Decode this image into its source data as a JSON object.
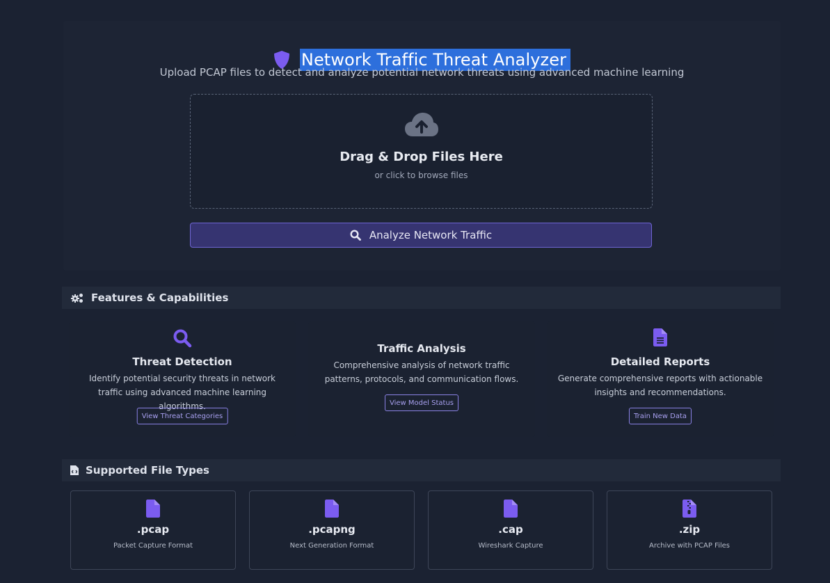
{
  "app": {
    "title": "Network Traffic Threat Analyzer",
    "subtitle": "Upload PCAP files to detect and analyze potential network threats using advanced machine learning"
  },
  "upload": {
    "drop_title": "Drag & Drop Files Here",
    "drop_subtitle": "or click to browse files",
    "icon": "cloud-upload-icon",
    "analyze_label": "Analyze Network Traffic"
  },
  "features": {
    "heading": "Features & Capabilities",
    "icon": "gears-icon",
    "items": [
      {
        "title": "Threat Detection",
        "description": "Identify potential security threats in network traffic using advanced machine learning algorithms.",
        "button": "View Threat Categories",
        "icon": "search-icon"
      },
      {
        "title": "Traffic Analysis",
        "description": "Comprehensive analysis of network traffic patterns, protocols, and communication flows.",
        "button": "View Model Status",
        "icon": ""
      },
      {
        "title": "Detailed Reports",
        "description": "Generate comprehensive reports with actionable insights and recommendations.",
        "button": "Train New Data",
        "icon": "file-text-icon"
      }
    ]
  },
  "file_types": {
    "heading": "Supported File Types",
    "icon": "file-code-icon",
    "items": [
      {
        "ext": ".pcap",
        "description": "Packet Capture Format",
        "icon": "file-icon"
      },
      {
        "ext": ".pcapng",
        "description": "Next Generation Format",
        "icon": "file-icon"
      },
      {
        "ext": ".cap",
        "description": "Wireshark Capture",
        "icon": "file-icon"
      },
      {
        "ext": ".zip",
        "description": "Archive with PCAP Files",
        "icon": "file-zip-icon"
      }
    ]
  },
  "colors": {
    "background": "#1b2232",
    "accent": "#7b5cf0",
    "title_highlight": "#2d6fdc",
    "button_bg": "#363471"
  }
}
